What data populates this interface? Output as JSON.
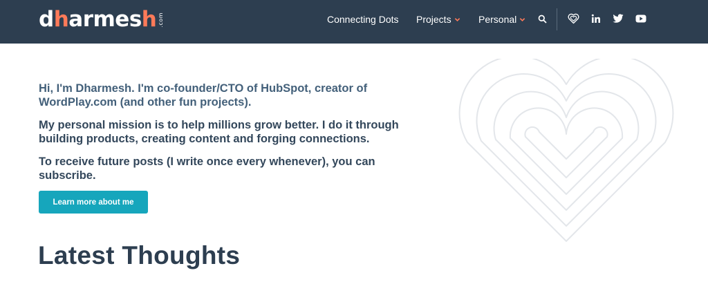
{
  "header": {
    "logo": {
      "prefix": "d",
      "accent": "h",
      "rest": "armes",
      "accent2": "h",
      "suffix": ".com"
    },
    "nav": [
      {
        "label": "Connecting Dots"
      },
      {
        "label": "Projects",
        "has_dropdown": true
      },
      {
        "label": "Personal",
        "has_dropdown": true
      }
    ],
    "icons": [
      "search-icon",
      "heart-icon",
      "linkedin-icon",
      "twitter-icon",
      "youtube-icon"
    ]
  },
  "intro": {
    "line1": "Hi, I'm Dharmesh. I'm co-founder/CTO of HubSpot, creator of WordPlay.com (and other fun projects).",
    "line2": "My personal mission is to help  millions grow better. I do it through building products, creating content and forging connections.",
    "line3": "To receive future posts (I write once every whenever), you can subscribe."
  },
  "cta": {
    "label": "Learn more about me"
  },
  "section": {
    "title": "Latest Thoughts"
  },
  "colors": {
    "header_bg": "#2d3e50",
    "accent": "#ff7a59",
    "button": "#16a6bc",
    "text": "#33475b"
  }
}
